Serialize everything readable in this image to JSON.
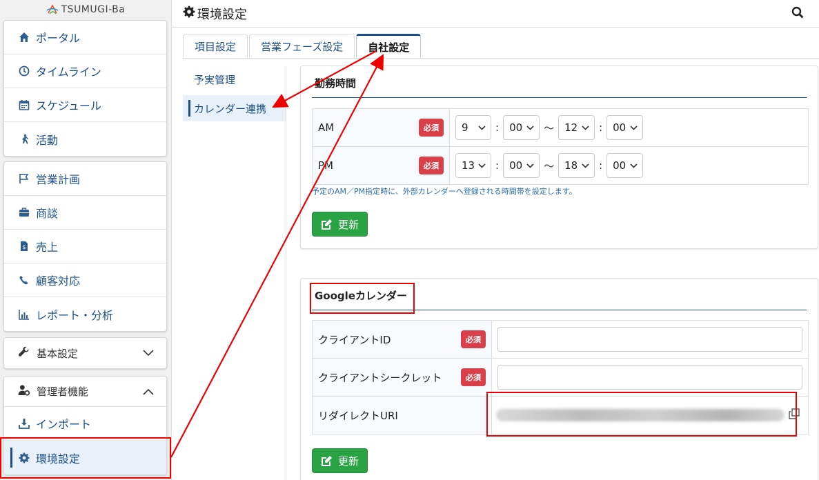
{
  "app": {
    "logo_text": "TSUMUGI-Ba"
  },
  "sidebar": {
    "group1": [
      {
        "label": "ポータル",
        "icon": "home-icon"
      },
      {
        "label": "タイムライン",
        "icon": "clock-icon"
      },
      {
        "label": "スケジュール",
        "icon": "calendar-icon"
      },
      {
        "label": "活動",
        "icon": "running-icon"
      }
    ],
    "group2": [
      {
        "label": "営業計画",
        "icon": "flag-icon"
      },
      {
        "label": "商談",
        "icon": "briefcase-icon"
      },
      {
        "label": "売上",
        "icon": "invoice-icon"
      },
      {
        "label": "顧客対応",
        "icon": "phone-icon"
      },
      {
        "label": "レポート・分析",
        "icon": "chart-icon"
      }
    ],
    "basic_settings": {
      "label": "基本設定",
      "icon": "wrench-icon"
    },
    "admin": {
      "label": "管理者機能",
      "icon": "user-gear-icon",
      "items": [
        {
          "label": "インポート",
          "icon": "download-icon"
        },
        {
          "label": "環境設定",
          "icon": "gear-icon"
        }
      ]
    }
  },
  "header": {
    "title": "環境設定"
  },
  "tabs": [
    {
      "label": "項目設定"
    },
    {
      "label": "営業フェーズ設定"
    },
    {
      "label": "自社設定"
    }
  ],
  "subnav": [
    {
      "label": "予実管理"
    },
    {
      "label": "カレンダー連携"
    }
  ],
  "work_hours": {
    "title": "勤務時間",
    "required_label": "必須",
    "rows": [
      {
        "label": "AM",
        "start_hour": "9",
        "start_min": "00",
        "end_hour": "12",
        "end_min": "00"
      },
      {
        "label": "PM",
        "start_hour": "13",
        "start_min": "00",
        "end_hour": "18",
        "end_min": "00"
      }
    ],
    "time_sep": ":",
    "range_sep": "〜",
    "note": "予定のAM／PM指定時に、外部カレンダーへ登録される時間帯を設定します。",
    "update_label": "更新"
  },
  "google_calendar": {
    "title": "Googleカレンダー",
    "required_label": "必須",
    "client_id_label": "クライアントID",
    "client_id_value": "",
    "client_secret_label": "クライアントシークレット",
    "client_secret_value": "",
    "redirect_uri_label": "リダイレクトURI",
    "update_label": "更新"
  },
  "colors": {
    "accent": "#1b4f8a",
    "required": "#d9404a",
    "button": "#2aa345",
    "annotation": "#e00000"
  }
}
